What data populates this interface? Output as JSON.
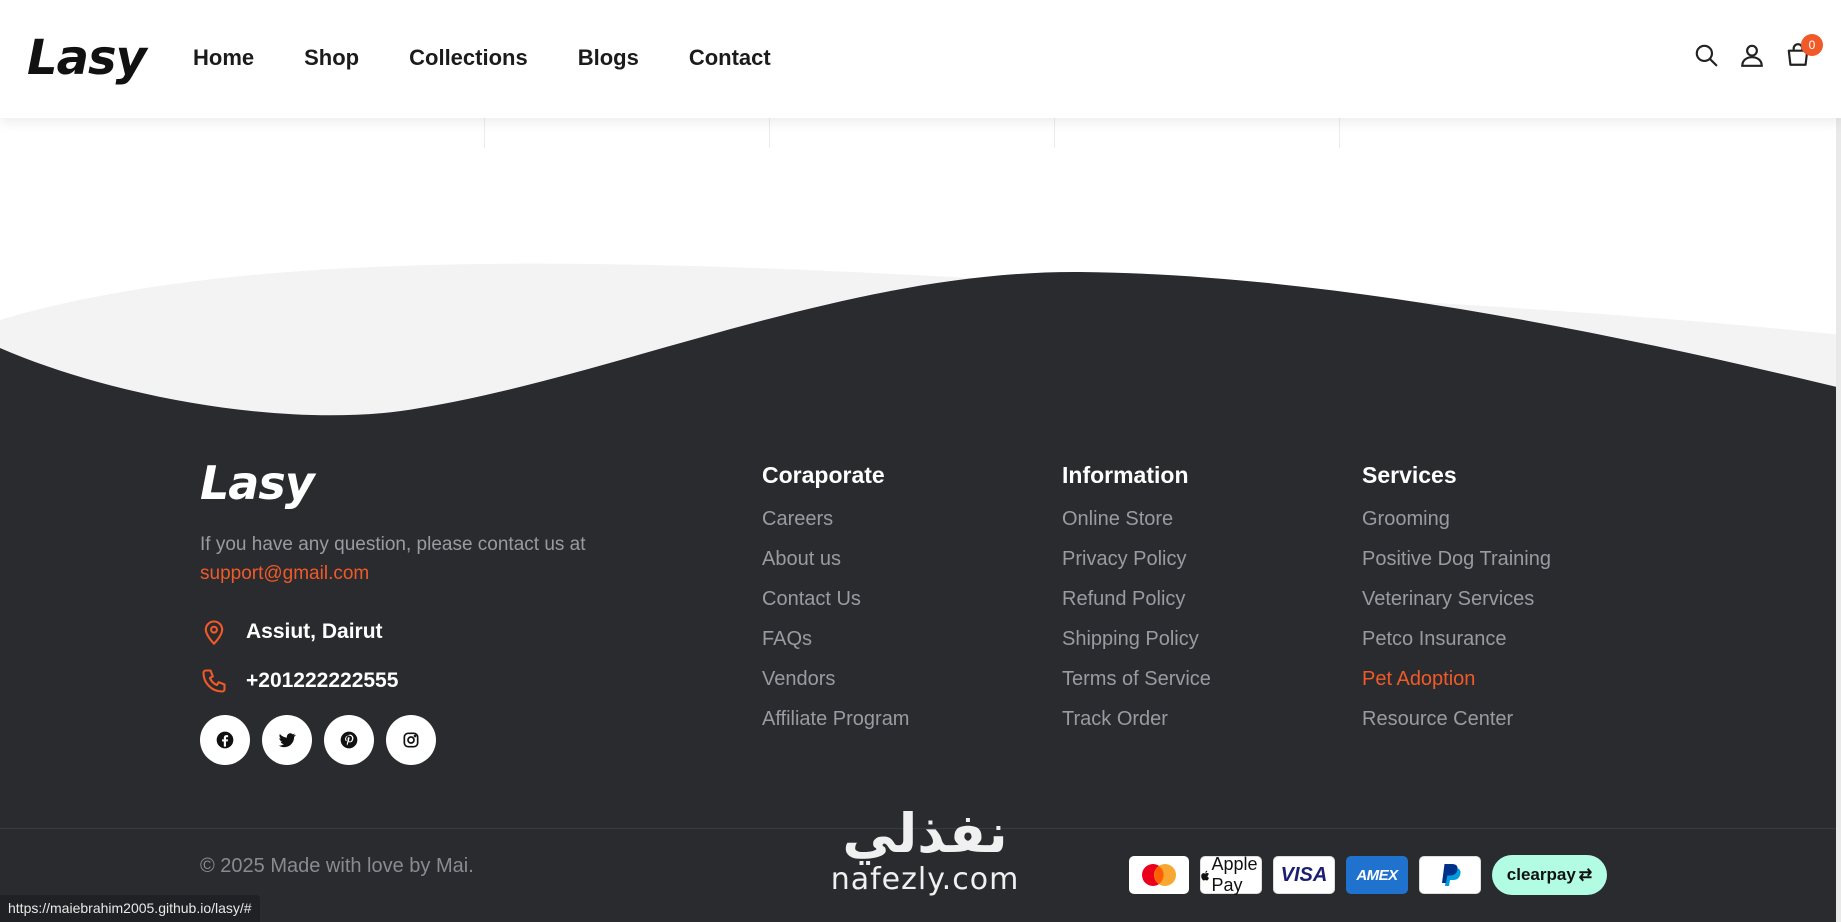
{
  "colors": {
    "accent": "#f05a28",
    "footer_bg": "#2a2b2f"
  },
  "header": {
    "logo": "Lasy",
    "nav": [
      "Home",
      "Shop",
      "Collections",
      "Blogs",
      "Contact"
    ],
    "icons": [
      "search-icon",
      "user-icon",
      "shopping-bag-icon"
    ],
    "cart_count": "0"
  },
  "footer": {
    "logo": "Lasy",
    "contact_text": "If you have any question, please contact us at",
    "email": "support@gmail.com",
    "address": "Assiut, Dairut",
    "phone": "+201222222555",
    "socials": [
      "facebook-icon",
      "twitter-icon",
      "pinterest-icon",
      "instagram-icon"
    ],
    "columns": [
      {
        "title": "Coraporate",
        "items": [
          "Careers",
          "About us",
          "Contact Us",
          "FAQs",
          "Vendors",
          "Affiliate Program"
        ]
      },
      {
        "title": "Information",
        "items": [
          "Online Store",
          "Privacy Policy",
          "Refund Policy",
          "Shipping Policy",
          "Terms of Service",
          "Track Order"
        ]
      },
      {
        "title": "Services",
        "items": [
          "Grooming",
          "Positive Dog Training",
          "Veterinary Services",
          "Petco Insurance",
          "Pet Adoption",
          "Resource Center"
        ],
        "active": "Pet Adoption"
      }
    ],
    "copyright": "© 2025 Made with love by Mai.",
    "payments": [
      "Apple Pay",
      "VISA",
      "AMEX",
      "clearpay"
    ]
  },
  "watermark": {
    "arabic": "نفذلي",
    "latin": "nafezly.com"
  },
  "status_bar": {
    "url": "https://maiebrahim2005.github.io/lasy/#"
  }
}
